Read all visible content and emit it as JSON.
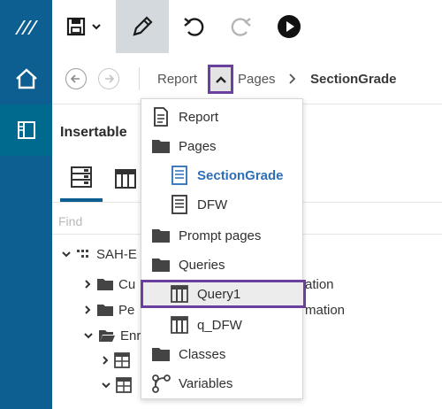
{
  "toolbar": {
    "icons": [
      "logo-icon",
      "save-icon",
      "pencil-icon",
      "undo-icon",
      "redo-icon",
      "run-icon"
    ]
  },
  "breadcrumb": {
    "report": "Report",
    "pages": "Pages",
    "current": "SectionGrade"
  },
  "panel": {
    "title": "Insertable",
    "find_placeholder": "Find",
    "tree": [
      {
        "label": "SAH-E",
        "expanded": true
      },
      {
        "label": "Cu",
        "tail": "ation"
      },
      {
        "label": "Pe",
        "tail": "mation"
      },
      {
        "label": "Enr",
        "expanded": true
      }
    ]
  },
  "menu": {
    "items": [
      {
        "label": "Report",
        "icon": "report-icon"
      },
      {
        "label": "Pages",
        "icon": "folder-icon"
      },
      {
        "label": "SectionGrade",
        "icon": "page-icon",
        "active": true
      },
      {
        "label": "DFW",
        "icon": "page-icon"
      },
      {
        "label": "Prompt pages",
        "icon": "folder-icon"
      },
      {
        "label": "Queries",
        "icon": "folder-icon"
      },
      {
        "label": "Query1",
        "icon": "query-icon",
        "highlighted": true
      },
      {
        "label": "q_DFW",
        "icon": "query-icon"
      },
      {
        "label": "Classes",
        "icon": "folder-icon"
      },
      {
        "label": "Variables",
        "icon": "variables-icon"
      }
    ]
  },
  "colors": {
    "rail": "#0d5f91",
    "highlight_border": "#6b3fa0",
    "active_link": "#2c6fb7"
  }
}
